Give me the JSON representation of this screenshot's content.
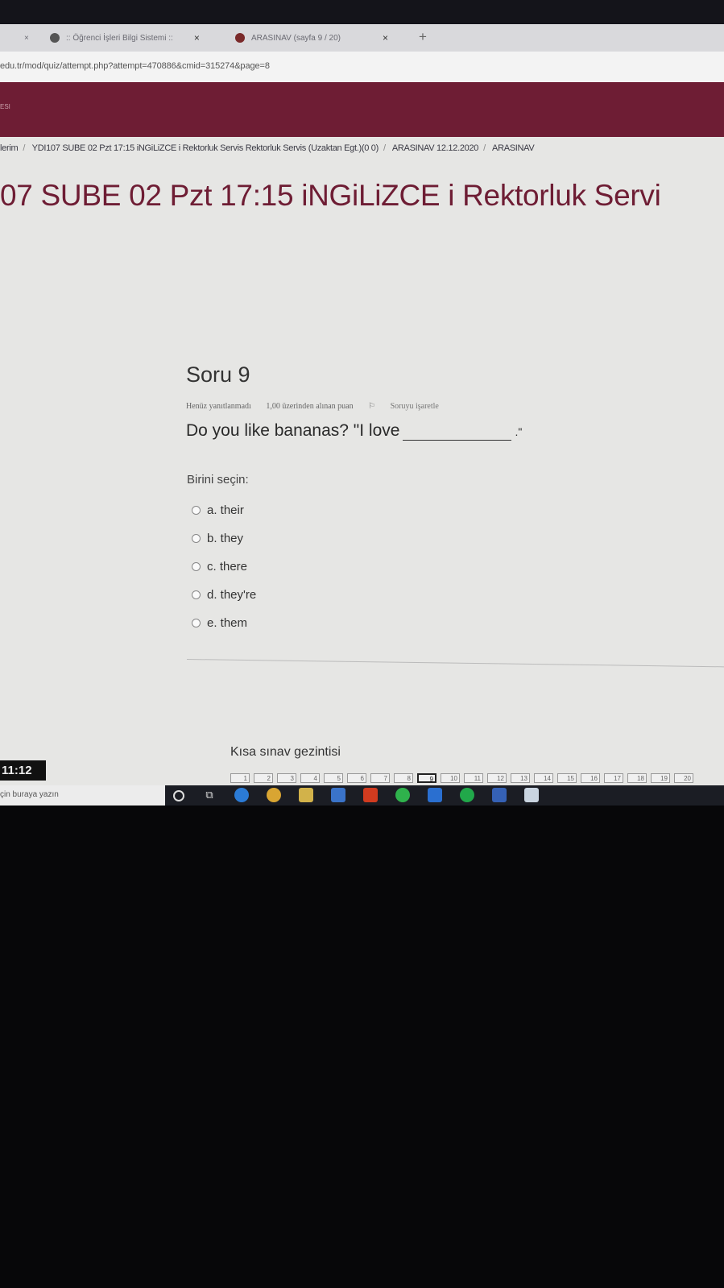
{
  "browser": {
    "tabs": [
      {
        "label": ":: Öğrenci İşleri Bilgi Sistemi ::",
        "close": "×"
      },
      {
        "label": "ARASINAV (sayfa 9 / 20)",
        "close": "×"
      }
    ],
    "first_close": "×",
    "new_tab": "+",
    "url": "edu.tr/mod/quiz/attempt.php?attempt=470886&cmid=315274&page=8"
  },
  "header": {
    "fragment": "ESI"
  },
  "breadcrumb": [
    "lerim",
    "YDI107 SUBE 02 Pzt 17:15 iNGiLiZCE i Rektorluk Servis Rektorluk Servis (Uzaktan Egt.)(0 0)",
    "ARASINAV 12.12.2020",
    "ARASINAV"
  ],
  "page_title": "07 SUBE 02 Pzt 17:15 iNGiLiZCE i Rektorluk Servi",
  "question": {
    "heading": "Soru 9",
    "status": "Henüz yanıtlanmadı",
    "marks": "1,00 üzerinden alınan puan",
    "flag_label": "Soruyu işaretle",
    "text": "Do you like bananas? \"I love",
    "ending": ".\"",
    "prompt": "Birini seçin:",
    "answers": [
      "a. their",
      "b. they",
      "c. there",
      "d. they're",
      "e. them"
    ]
  },
  "quiz_nav": {
    "title": "Kısa sınav gezintisi",
    "pages": [
      "1",
      "2",
      "3",
      "4",
      "5",
      "6",
      "7",
      "8",
      "9",
      "10",
      "11",
      "12",
      "13",
      "14",
      "15",
      "16",
      "17",
      "18",
      "19",
      "20"
    ],
    "current": "9"
  },
  "clock": "11:12",
  "taskbar": {
    "search_placeholder": "çin buraya yazın"
  }
}
